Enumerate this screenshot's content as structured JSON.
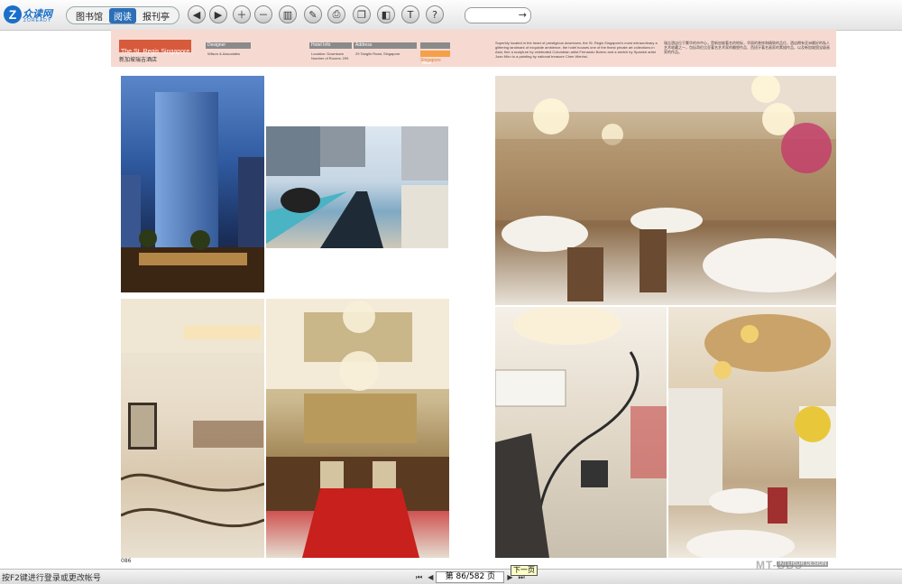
{
  "app": {
    "logo_text": "众读网",
    "logo_sub": "ZOREADY",
    "tabs": [
      "图书馆",
      "阅读",
      "报刊亭"
    ],
    "active_tab": 1,
    "goto_arrow": "→"
  },
  "spread": {
    "title": "The St. Regis Singapore",
    "subtitle_cn": "新加坡瑞吉酒店",
    "designer_label": "Designer",
    "designer_value": "Wilson & Associates",
    "info_label": "Hotel Info",
    "info_value1": "Location: Downtown",
    "info_value2": "Number of Rooms: 299",
    "address_label": "Address",
    "address_value": "29 Tanglin Road, Singapore",
    "region_label": "Region",
    "region_value": "Asia",
    "region_sub": "Singapore",
    "desc_en": "Superbly located in the heart of prestigious downtown, the St. Regis Singapore's most extraordinary a glittering landmark of exquisite ambience, the hotel houses one of the finest private art collections in Asia, fine a sculpture by celebrated Colombian artist Fernando Botero and a sketch by Spanish artist Joan Miro to a painting by national treasure Chen Wenhsi.",
    "desc_cn": "瑞吉酒店位于繁华的市中心，是新加坡著名的地标，华丽的装饰和精致的品位，酒店拥有亚洲最好的私人艺术收藏之一，包括哥伦比亚著名艺术家的雕塑作品、西班牙著名画家的素描作品，以及新加坡国宝级画家的作品。",
    "page_number": "086"
  },
  "bottom": {
    "status": "按F2键进行登录或更改帐号",
    "page_indicator": "第 86/582 页",
    "next_label": "下一页",
    "watermark": "MT-BBS",
    "watermark_sub": "INTERIOR DESIGN",
    "first_icon": "⏮",
    "prev_icon": "◀",
    "next_icon": "▶",
    "last_icon": "⏭"
  }
}
